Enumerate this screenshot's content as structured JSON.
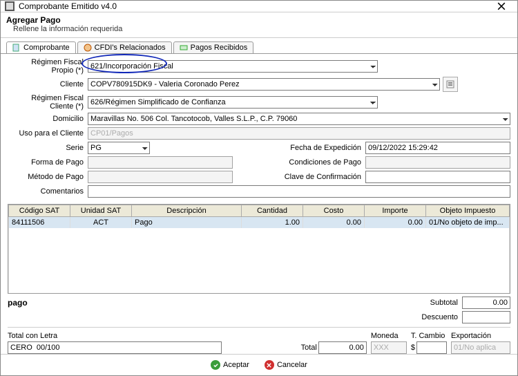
{
  "window": {
    "title": "Comprobante Emitido v4.0"
  },
  "header": {
    "title": "Agregar Pago",
    "subtitle": "Rellene la información requerida"
  },
  "tabs": [
    {
      "label": "Comprobante"
    },
    {
      "label": "CFDI's Relacionados"
    },
    {
      "label": "Pagos Recibidos"
    }
  ],
  "form": {
    "regimen_propio": {
      "label": "Régimen Fiscal Propio (*)",
      "value": "621/Incorporación Fiscal"
    },
    "cliente": {
      "label": "Cliente",
      "value": "COPV780915DK9 - Valeria Coronado Perez"
    },
    "regimen_cliente": {
      "label": "Régimen Fiscal Cliente (*)",
      "value": "626/Régimen Simplificado de Confianza"
    },
    "domicilio": {
      "label": "Domicilio",
      "value": "Maravillas No. 506 Col. Tancotocob, Valles S.L.P., C.P. 79060"
    },
    "uso_cliente": {
      "label": "Uso para el Cliente",
      "value": "CP01/Pagos"
    },
    "serie": {
      "label": "Serie",
      "value": "PG"
    },
    "fecha_exp": {
      "label": "Fecha de Expedición",
      "value": "09/12/2022 15:29:42"
    },
    "forma_pago": {
      "label": "Forma de Pago",
      "value": ""
    },
    "cond_pago": {
      "label": "Condiciones de Pago",
      "value": ""
    },
    "metodo_pago": {
      "label": "Método de Pago",
      "value": ""
    },
    "clave_conf": {
      "label": "Clave de Confirmación",
      "value": ""
    },
    "comentarios": {
      "label": "Comentarios",
      "value": ""
    }
  },
  "grid": {
    "headers": [
      "Código SAT",
      "Unidad SAT",
      "Descripción",
      "Cantidad",
      "Costo",
      "Importe",
      "Objeto Impuesto"
    ],
    "rows": [
      {
        "codigo": "84111506",
        "unidad": "ACT",
        "descripcion": "Pago",
        "cantidad": "1.00",
        "costo": "0.00",
        "importe": "0.00",
        "objeto": "01/No objeto de imp..."
      }
    ]
  },
  "selected": {
    "desc": "pago"
  },
  "totals": {
    "subtotal": {
      "label": "Subtotal",
      "value": "0.00"
    },
    "descuento": {
      "label": "Descuento",
      "value": ""
    },
    "total": {
      "label": "Total",
      "value": "0.00"
    }
  },
  "footer": {
    "total_letra": {
      "label": "Total con Letra",
      "value": "CERO  00/100"
    },
    "moneda": {
      "label": "Moneda",
      "value": "XXX"
    },
    "tcambio": {
      "label": "T. Cambio",
      "symbol": "$",
      "value": ""
    },
    "exportacion": {
      "label": "Exportación",
      "value": "01/No aplica"
    }
  },
  "buttons": {
    "accept": "Aceptar",
    "cancel": "Cancelar"
  }
}
